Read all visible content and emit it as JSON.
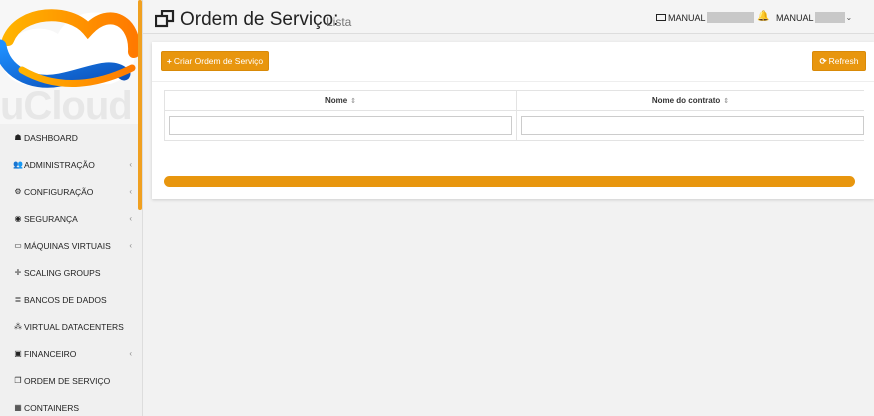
{
  "brand": {
    "logo_text": "uCloud"
  },
  "sidebar": {
    "items": [
      {
        "label": "DASHBOARD",
        "icon": "dashboard-icon",
        "glyph": "☗",
        "chevron": false
      },
      {
        "label": "ADMINISTRAÇÃO",
        "icon": "users-icon",
        "glyph": "👥",
        "chevron": true
      },
      {
        "label": "CONFIGURAÇÃO",
        "icon": "gear-icon",
        "glyph": "⚙",
        "chevron": true
      },
      {
        "label": "SEGURANÇA",
        "icon": "shield-icon",
        "glyph": "◉",
        "chevron": true
      },
      {
        "label": "MÁQUINAS VIRTUAIS",
        "icon": "monitor-icon",
        "glyph": "▭",
        "chevron": true
      },
      {
        "label": "SCALING GROUPS",
        "icon": "arrows-icon",
        "glyph": "✛",
        "chevron": false
      },
      {
        "label": "BANCOS DE DADOS",
        "icon": "database-icon",
        "glyph": "≣",
        "chevron": false
      },
      {
        "label": "VIRTUAL DATACENTERS",
        "icon": "sitemap-icon",
        "glyph": "⁂",
        "chevron": false
      },
      {
        "label": "FINANCEIRO",
        "icon": "money-icon",
        "glyph": "▣",
        "chevron": true
      },
      {
        "label": "ORDEM DE SERVIÇO",
        "icon": "clone-icon",
        "glyph": "❐",
        "chevron": false
      },
      {
        "label": "CONTAINERS",
        "icon": "grid-icon",
        "glyph": "▦",
        "chevron": false
      }
    ],
    "chevron_glyph": "‹"
  },
  "header": {
    "title": "Ordem de Serviço:",
    "subtitle": "Lista",
    "user_card_label": "MANUAL",
    "user_label": "MANUAL",
    "bell_glyph": "🔔",
    "dropdown_glyph": "⌄"
  },
  "toolbar": {
    "create_label": "Criar Ordem de Serviço",
    "create_glyph": "+",
    "refresh_label": "Refresh",
    "refresh_glyph": "⟳"
  },
  "table": {
    "columns": [
      {
        "label": "Nome",
        "sort_glyph": "⇕"
      },
      {
        "label": "Nome do contrato",
        "sort_glyph": "⇕"
      }
    ],
    "filters": [
      {
        "value": "",
        "placeholder": ""
      },
      {
        "value": "",
        "placeholder": ""
      }
    ]
  },
  "loading": {
    "progress": 1.0
  },
  "colors": {
    "accent": "#e8960e",
    "logo_blue": "#1a6fd6",
    "logo_orange": "#f5a30a"
  }
}
